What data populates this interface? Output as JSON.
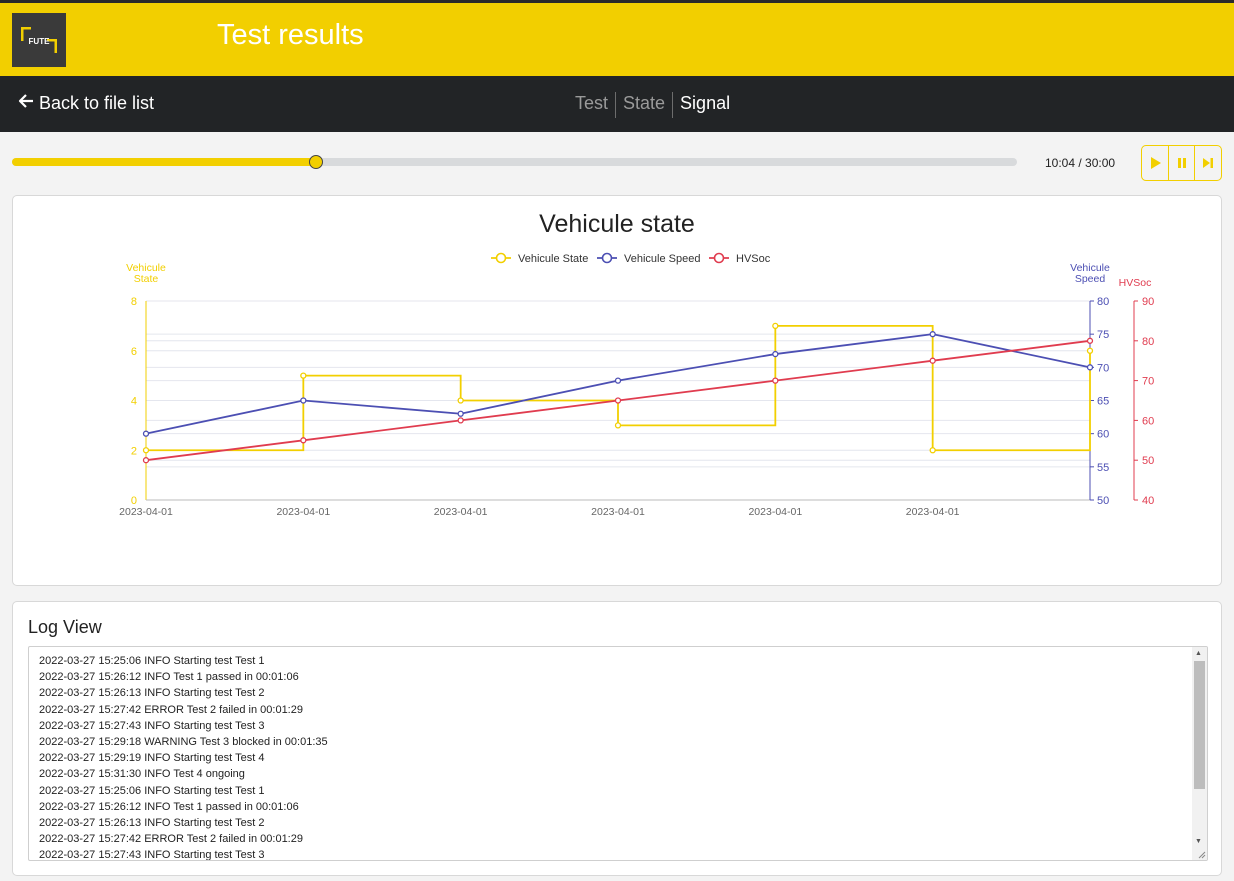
{
  "header": {
    "title": "Test results",
    "logo_text": "FUTE"
  },
  "nav": {
    "back_label": "Back to file list",
    "tabs": [
      {
        "label": "Test",
        "active": false
      },
      {
        "label": "State",
        "active": false
      },
      {
        "label": "Signal",
        "active": true
      }
    ]
  },
  "player": {
    "progress_fraction": 0.3022,
    "time_display": "10:04 / 30:00",
    "buttons": [
      "play-icon",
      "pause-icon",
      "skip-forward-icon"
    ]
  },
  "colors": {
    "accent": "#f2cf00",
    "dark": "#222426",
    "speed": "#4c4fb3",
    "hvsoc": "#e03c4f",
    "state": "#f2cf00"
  },
  "chart_data": {
    "type": "line",
    "title": "Vehicule state",
    "legend": "top-center",
    "x": [
      "2023-04-01",
      "2023-04-01",
      "2023-04-01",
      "2023-04-01",
      "2023-04-01",
      "2023-04-01",
      ""
    ],
    "x_tick_labels": [
      "2023-04-01",
      "2023-04-01",
      "2023-04-01",
      "2023-04-01",
      "2023-04-01",
      "2023-04-01"
    ],
    "series": [
      {
        "name": "Vehicule State",
        "axis": "left",
        "step": true,
        "values": [
          2,
          5,
          4,
          3,
          7,
          2,
          6
        ]
      },
      {
        "name": "Vehicule Speed",
        "axis": "right1",
        "values": [
          60,
          65,
          63,
          68,
          72,
          75,
          70
        ]
      },
      {
        "name": "HVSoc",
        "axis": "right2",
        "values": [
          50,
          55,
          60,
          65,
          70,
          75,
          80
        ]
      }
    ],
    "axes": {
      "left": {
        "label": [
          "Vehicule",
          "State"
        ],
        "ylim": [
          0,
          8
        ],
        "ticks": [
          "0",
          "2",
          "4",
          "6",
          "8"
        ]
      },
      "right1": {
        "label": [
          "Vehicule",
          "Speed"
        ],
        "ylim": [
          50,
          80
        ],
        "ticks": [
          "50",
          "55",
          "60",
          "65",
          "70",
          "75",
          "80"
        ]
      },
      "right2": {
        "label": [
          "HVSoc"
        ],
        "ylim": [
          40,
          90
        ],
        "ticks": [
          "40",
          "50",
          "60",
          "70",
          "80",
          "90"
        ]
      }
    },
    "grid": true
  },
  "log": {
    "title": "Log View",
    "lines": [
      "2022-03-27 15:25:06 INFO Starting test Test 1",
      "2022-03-27 15:26:12 INFO Test 1 passed in 00:01:06",
      "2022-03-27 15:26:13 INFO Starting test Test 2",
      "2022-03-27 15:27:42 ERROR Test 2 failed in 00:01:29",
      "2022-03-27 15:27:43 INFO Starting test Test 3",
      "2022-03-27 15:29:18 WARNING Test 3 blocked in 00:01:35",
      "2022-03-27 15:29:19 INFO Starting test Test 4",
      "2022-03-27 15:31:30 INFO Test 4 ongoing",
      "2022-03-27 15:25:06 INFO Starting test Test 1",
      "2022-03-27 15:26:12 INFO Test 1 passed in 00:01:06",
      "2022-03-27 15:26:13 INFO Starting test Test 2",
      "2022-03-27 15:27:42 ERROR Test 2 failed in 00:01:29",
      "2022-03-27 15:27:43 INFO Starting test Test 3"
    ]
  }
}
